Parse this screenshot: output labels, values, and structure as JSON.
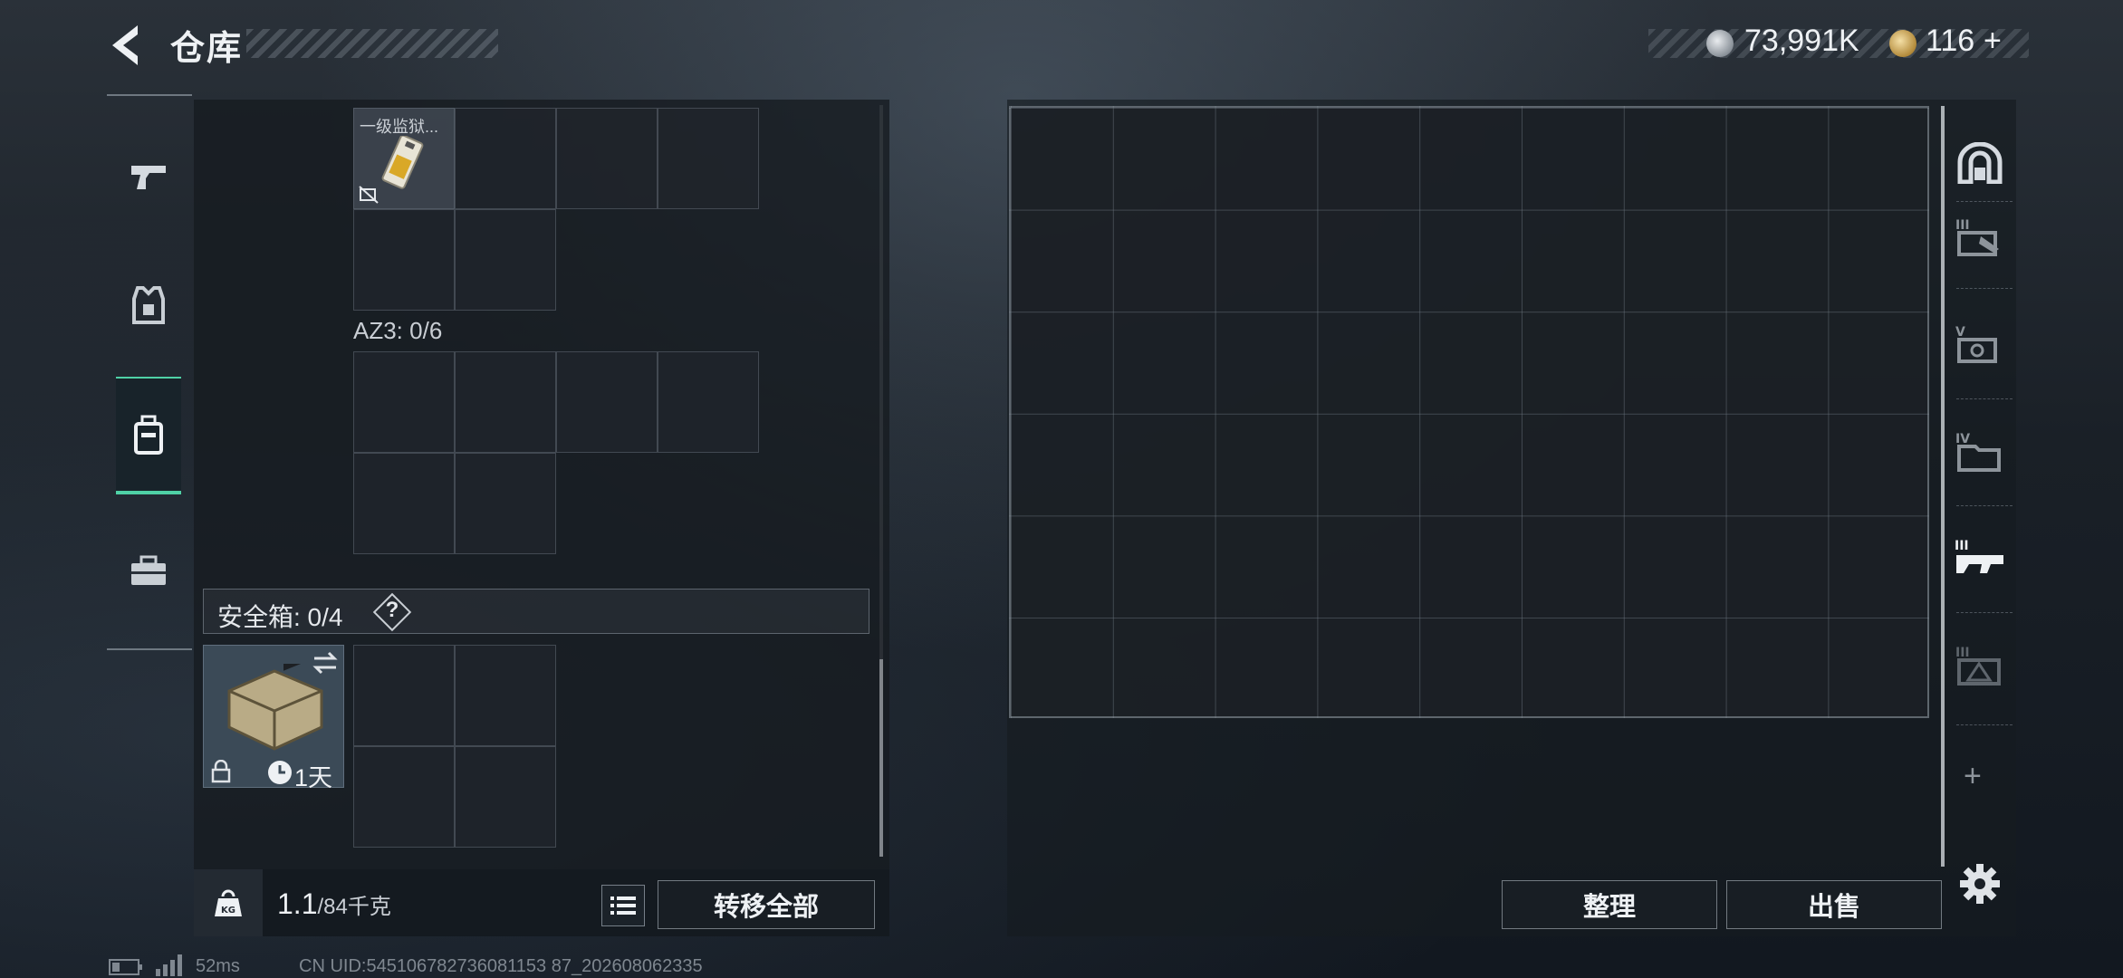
{
  "header": {
    "title": "仓库",
    "back_icon": "chevron-left-icon",
    "currency_silver": "73,991K",
    "currency_gold": "116",
    "currency_gold_add": "+"
  },
  "side_tabs": [
    {
      "icon": "pistol-icon"
    },
    {
      "icon": "armor-vest-icon"
    },
    {
      "icon": "backpack-icon",
      "active": true
    },
    {
      "icon": "briefcase-icon"
    }
  ],
  "left_panel": {
    "card_label": "一级监狱...",
    "az3_label": "AZ3: 0/6",
    "safe_box_label": "安全箱: 0/4",
    "help_label": "?",
    "case_duration": "1天",
    "weight_value": "1.1",
    "weight_capacity": "/84千克",
    "transfer_all": "转移全部"
  },
  "right_panel": {
    "organize": "整理",
    "sell": "出售"
  },
  "right_rail": {
    "tabs": [
      {
        "icon": "stash-home-icon"
      },
      {
        "icon": "stash-tier-iii-icon",
        "label": "III"
      },
      {
        "icon": "stash-tier-v-icon",
        "label": "V"
      },
      {
        "icon": "stash-tier-iv-icon",
        "label": "IV"
      },
      {
        "icon": "stash-tier-iii-rifle-icon",
        "label": "III"
      },
      {
        "icon": "stash-tier-iii-armor-icon",
        "label": "III"
      }
    ],
    "add": "+"
  },
  "status_bar": {
    "ping": "52ms",
    "uid": "CN UID:545106782736081153 87_202608062335"
  }
}
